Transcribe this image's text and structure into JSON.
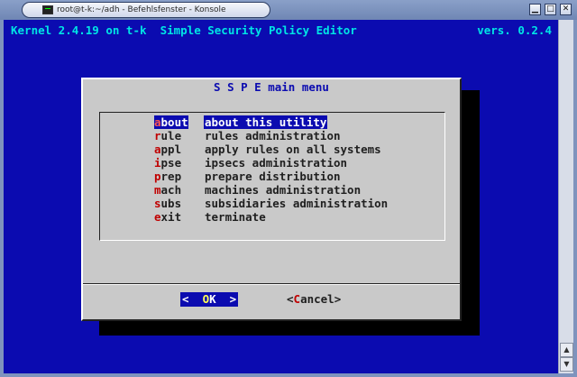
{
  "window": {
    "title": "root@t-k:~/adh - Befehlsfenster - Konsole",
    "buttons": {
      "minimize": "▁",
      "maximize": "□",
      "close": "✕"
    }
  },
  "header": {
    "left": "Kernel 2.4.19 on t-k  Simple Security Policy Editor",
    "right": "vers. 0.2.4"
  },
  "dialog": {
    "title": " S S P E main menu ",
    "items": [
      {
        "hot": "a",
        "rest": "bout",
        "desc": "about this utility",
        "selected": true
      },
      {
        "hot": "r",
        "rest": "ule",
        "desc": "rules administration"
      },
      {
        "hot": "a",
        "rest": "ppl",
        "desc": "apply rules on all systems"
      },
      {
        "hot": "i",
        "rest": "pse",
        "desc": "ipsecs administration"
      },
      {
        "hot": "p",
        "rest": "rep",
        "desc": "prepare distribution"
      },
      {
        "hot": "m",
        "rest": "ach",
        "desc": "machines administration"
      },
      {
        "hot": "s",
        "rest": "ubs",
        "desc": "subsidiaries administration"
      },
      {
        "hot": "e",
        "rest": "xit",
        "desc": "terminate"
      }
    ],
    "ok": {
      "pre": "<  ",
      "hot": "O",
      "post": "K  >"
    },
    "cancel": {
      "pre": "<",
      "hot": "C",
      "post": "ancel>"
    }
  },
  "colors": {
    "terminal_bg": "#0b0bb0",
    "header_text": "#00e5e5",
    "dialog_bg": "#c9c9c9",
    "hotkey": "#c00000",
    "selection_bg": "#0b0bb0"
  }
}
